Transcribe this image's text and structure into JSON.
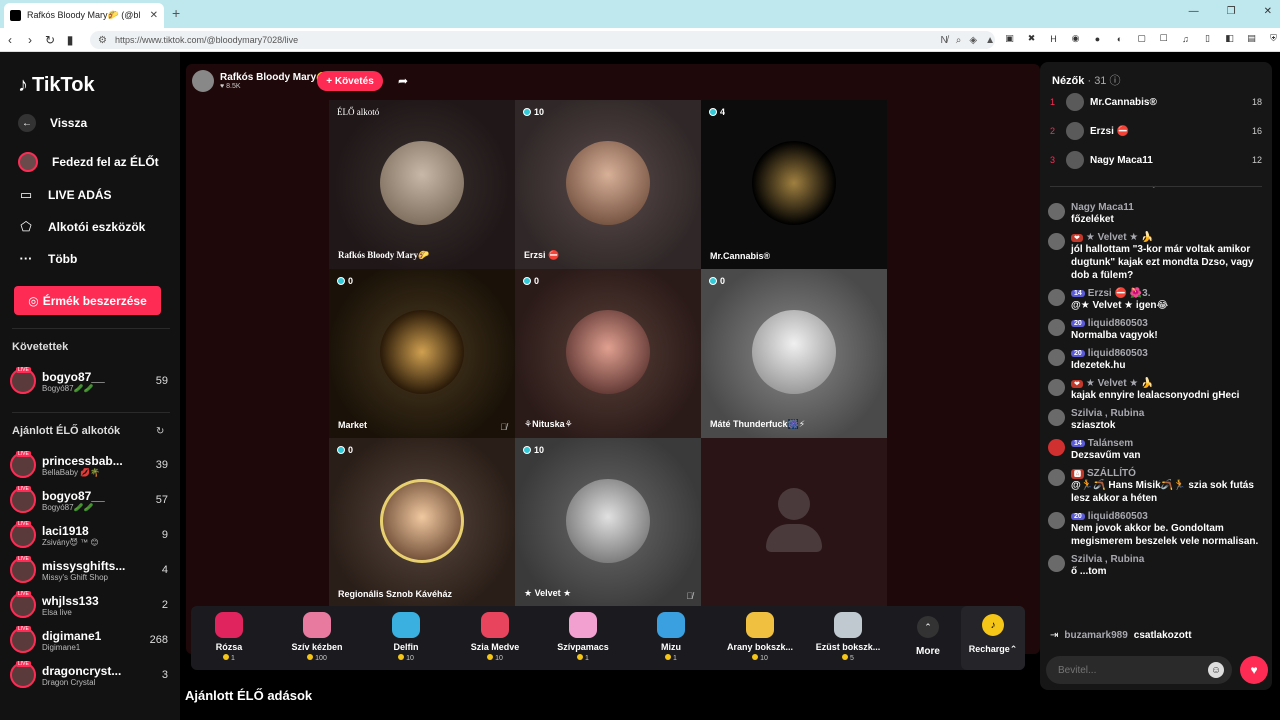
{
  "browser": {
    "tab_title": "Rafkós Bloody Mary🌮 (@bl",
    "url": "https://www.tiktok.com/@bloodymary7028/live"
  },
  "sidebar": {
    "brand": "TikTok",
    "back": "Vissza",
    "nav": [
      {
        "label": "Fedezd fel az ÉLŐt"
      },
      {
        "label": "LIVE ADÁS"
      },
      {
        "label": "Alkotói eszközök"
      },
      {
        "label": "Több"
      }
    ],
    "coins_button": "Érmék beszerzése",
    "following_title": "Követettek",
    "following": [
      {
        "name": "bogyo87__",
        "sub": "Bogyó87🥒🥒",
        "count": "59"
      }
    ],
    "suggested_title": "Ajánlott ÉLŐ alkotók",
    "suggested": [
      {
        "name": "princessbab...",
        "sub": "BellaBaby 💋🌴",
        "count": "39"
      },
      {
        "name": "bogyo87__",
        "sub": "Bogyó87🥒🥒",
        "count": "57"
      },
      {
        "name": "laci1918",
        "sub": "Zsivány😈 ™ 😊",
        "count": "9"
      },
      {
        "name": "missysghifts...",
        "sub": "Missy's Ghift Shop",
        "count": "4"
      },
      {
        "name": "whjlss133",
        "sub": "Elsa live",
        "count": "2"
      },
      {
        "name": "digimane1",
        "sub": "Digimane1",
        "count": "268"
      },
      {
        "name": "dragoncryst...",
        "sub": "Dragon Crystal",
        "count": "3"
      }
    ]
  },
  "host": {
    "name": "Rafkós Bloody Mary🌮",
    "likes": "♥ 8.5K",
    "follow_label": "+ Követés"
  },
  "guests": [
    {
      "name": "Rafkós Bloody Mary🌮",
      "label": "ÉLŐ alkotó",
      "viewers": ""
    },
    {
      "name": "Erzsi ⛔",
      "label": "",
      "viewers": "10"
    },
    {
      "name": "Mr.Cannabis®",
      "label": "",
      "viewers": "4"
    },
    {
      "name": "Market",
      "label": "",
      "viewers": "0"
    },
    {
      "name": "⚘Nituska⚘",
      "label": "",
      "viewers": "0"
    },
    {
      "name": "Máté Thunderfuck🎆⚡",
      "label": "",
      "viewers": "0"
    },
    {
      "name": "Regionális Sznob Kávéház",
      "label": "",
      "viewers": "0"
    },
    {
      "name": "★ Velvet ★",
      "label": "",
      "viewers": "10"
    }
  ],
  "gifts": [
    {
      "name": "Rózsa",
      "price": "1",
      "color": "#e0245e"
    },
    {
      "name": "Szív kézben",
      "price": "100",
      "color": "#e87aa0"
    },
    {
      "name": "Delfin",
      "price": "10",
      "color": "#3ab0e0"
    },
    {
      "name": "Szia Medve",
      "price": "10",
      "color": "#e8445e"
    },
    {
      "name": "Szívpamacs",
      "price": "1",
      "color": "#f2a0d0"
    },
    {
      "name": "Mizu",
      "price": "1",
      "color": "#3aa0e0"
    },
    {
      "name": "Arany bokszk...",
      "price": "10",
      "color": "#f0c040"
    },
    {
      "name": "Ezüst bokszk...",
      "price": "5",
      "color": "#c0c8d0"
    }
  ],
  "more_label": "More",
  "recharge_label": "Recharge⌃",
  "recommended_title": "Ajánlott ÉLŐ adások",
  "viewers_panel": {
    "title": "Nézők",
    "count": "· 31",
    "top": [
      {
        "rank": "1",
        "name": "Mr.Cannabis®",
        "score": "18"
      },
      {
        "rank": "2",
        "name": "Erzsi ⛔",
        "score": "16"
      },
      {
        "rank": "3",
        "name": "Nagy Maca11",
        "score": "12"
      }
    ]
  },
  "chat": [
    {
      "user": "Nagy Maca11",
      "badge": "",
      "text": "főzeléket"
    },
    {
      "user": "★ Velvet ★ 🍌",
      "badge": "❤",
      "text": "jól hallottam \"3-kor már voltak amikor dugtunk\" kajak ezt mondta Dzso, vagy dob a fülem?"
    },
    {
      "user": "Erzsi ⛔ 🌺3.",
      "badge": "14",
      "text": "@★ Velvet ★ igen😂"
    },
    {
      "user": "liquid860503",
      "badge": "20",
      "text": "Normalba vagyok!"
    },
    {
      "user": "liquid860503",
      "badge": "20",
      "text": "Idezetek.hu"
    },
    {
      "user": "★ Velvet ★ 🍌",
      "badge": "❤",
      "text": "kajak ennyire lealacsonyodni gHeci"
    },
    {
      "user": "Szilvia , Rubina",
      "badge": "",
      "text": "sziasztok"
    },
    {
      "user": "Talánsem",
      "badge": "14",
      "text": "Dezsavűm van"
    },
    {
      "user": "SZÁLLÍTÓ",
      "badge": "🅰",
      "text": "@🏃🪃 Hans Misik🪃🏃 szia sok futás lesz akkor a héten"
    },
    {
      "user": "liquid860503",
      "badge": "20",
      "text": "Nem jovok akkor be. Gondoltam megismerem beszelek vele normalisan."
    },
    {
      "user": "Szilvia , Rubina",
      "badge": "",
      "text": "ő ...tom"
    }
  ],
  "joined": {
    "user": "buzamark989",
    "text": "csatlakozott"
  },
  "input_placeholder": "Bevitel..."
}
